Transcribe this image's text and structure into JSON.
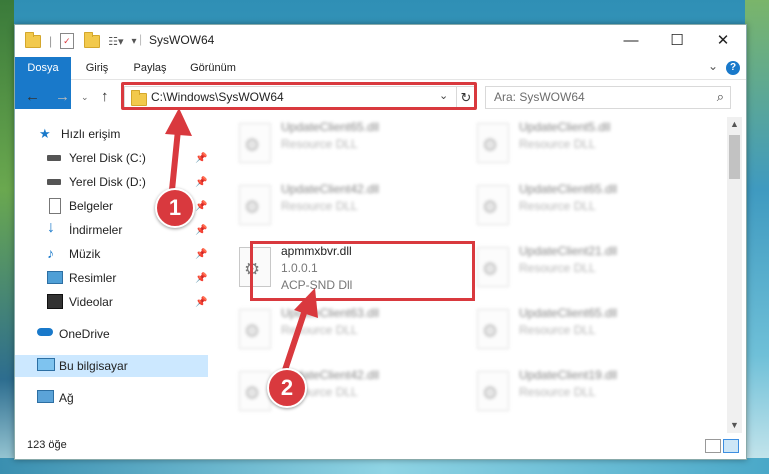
{
  "window": {
    "title": "SysWOW64",
    "controls": {
      "minimize": "—",
      "maximize": "☐",
      "close": "✕"
    }
  },
  "ribbon": {
    "tabs": [
      "Dosya",
      "Giriş",
      "Paylaş",
      "Görünüm"
    ],
    "help": "?"
  },
  "address_bar": {
    "path": "C:\\Windows\\SysWOW64",
    "search_placeholder": "Ara: SysWOW64"
  },
  "nav_pane": {
    "items": [
      {
        "label": "Hızlı erişim",
        "icon": "star-icon"
      },
      {
        "label": "Yerel Disk (C:)",
        "icon": "drive-icon",
        "pinned": true
      },
      {
        "label": "Yerel Disk (D:)",
        "icon": "drive-icon",
        "pinned": true
      },
      {
        "label": "Belgeler",
        "icon": "documents-icon",
        "pinned": true
      },
      {
        "label": "İndirmeler",
        "icon": "download-icon",
        "pinned": true
      },
      {
        "label": "Müzik",
        "icon": "music-icon",
        "pinned": true
      },
      {
        "label": "Resimler",
        "icon": "pictures-icon",
        "pinned": true
      },
      {
        "label": "Videolar",
        "icon": "videos-icon",
        "pinned": true
      },
      {
        "label": "OneDrive",
        "icon": "cloud-icon"
      },
      {
        "label": "Bu bilgisayar",
        "icon": "computer-icon",
        "selected": true
      },
      {
        "label": "Ağ",
        "icon": "network-icon"
      }
    ]
  },
  "files": {
    "left": [
      {
        "name": "UpdateClient65.dll",
        "type": "Resource DLL"
      },
      {
        "name": "UpdateClient42.dll",
        "type": "Resource DLL"
      },
      {
        "name": "apmmxbvr.dll",
        "version": "1.0.0.1",
        "type": "ACP-SND Dll"
      },
      {
        "name": "UpdateClient63.dll",
        "type": "Resource DLL"
      },
      {
        "name": "UpdateClient42.dll",
        "type": "Resource DLL"
      }
    ],
    "right": [
      {
        "name": "UpdateClient5.dll",
        "type": "Resource DLL"
      },
      {
        "name": "UpdateClient65.dll",
        "type": "Resource DLL"
      },
      {
        "name": "UpdateClient21.dll",
        "type": "Resource DLL"
      },
      {
        "name": "UpdateClient65.dll",
        "type": "Resource DLL"
      },
      {
        "name": "UpdateClient19.dll",
        "type": "Resource DLL"
      }
    ]
  },
  "status": {
    "item_count": "123 öğe"
  },
  "callouts": {
    "one": "1",
    "two": "2"
  },
  "colors": {
    "accent": "#1979ca",
    "highlight": "#d9393e",
    "selection": "#cce8ff"
  }
}
